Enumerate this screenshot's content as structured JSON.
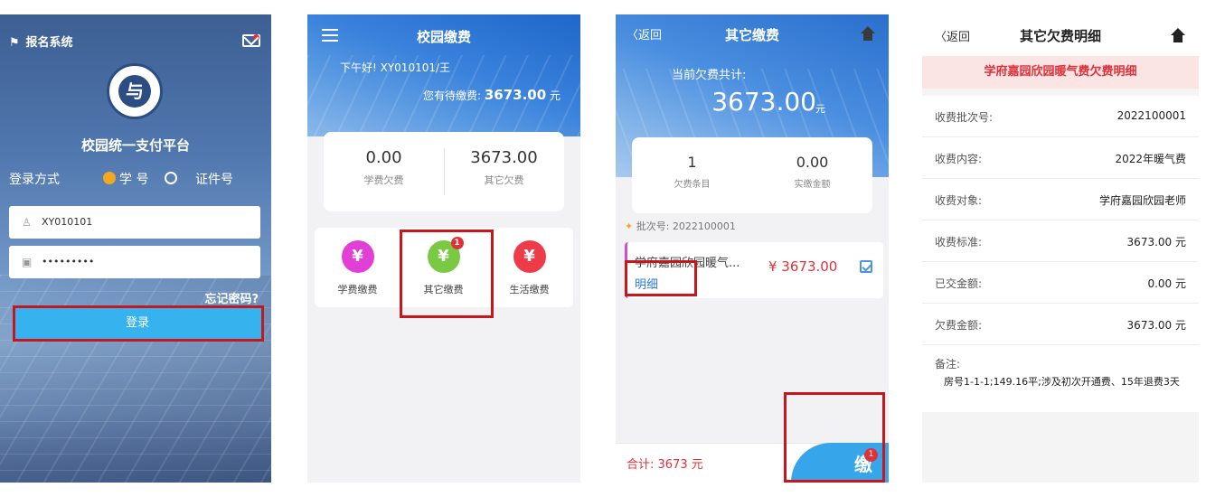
{
  "screen1": {
    "app_name": "报名系统",
    "platform_name": "校园统一支付平台",
    "login_method_label": "登录方式",
    "option_student_id": "学 号",
    "option_id_card": "证件号",
    "username_value": "XY010101",
    "password_value": "•••••••••",
    "forgot_password": "忘记密码?",
    "login_button": "登录"
  },
  "screen2": {
    "title": "校园缴费",
    "greeting": "下午好! XY010101/王",
    "pending_label": "您有待缴费:",
    "pending_amount": "3673.00",
    "pending_unit": "元",
    "stats": [
      {
        "value": "0.00",
        "label": "学费欠费"
      },
      {
        "value": "3673.00",
        "label": "其它欠费"
      }
    ],
    "tiles": [
      {
        "label": "学费缴费",
        "glyph": "¥",
        "color": "#e23fd6"
      },
      {
        "label": "其它缴费",
        "glyph": "¥",
        "color": "#7ac943",
        "badge": "1"
      },
      {
        "label": "生活缴费",
        "glyph": "¥",
        "color": "#ee3b4a"
      }
    ]
  },
  "screen3": {
    "back_label": "返回",
    "title": "其它缴费",
    "arrears_label": "当前欠费共计:",
    "arrears_amount": "3673.00",
    "arrears_unit": "元",
    "stats": [
      {
        "value": "1",
        "label": "欠费条目"
      },
      {
        "value": "0.00",
        "label": "实缴金额"
      }
    ],
    "batch_label": "批次号: 2022100001",
    "item_name": "学府嘉园欣园暖气...",
    "item_detail": "明细",
    "item_price": "¥ 3673.00",
    "total_label": "合计: 3673 元",
    "pay_button": "缴",
    "pay_badge": "1"
  },
  "screen4": {
    "back_label": "返回",
    "title": "其它欠费明细",
    "banner": "学府嘉园欣园暖气费欠费明细",
    "rows": [
      {
        "key": "收费批次号:",
        "value": "2022100001"
      },
      {
        "key": "收费内容:",
        "value": "2022年暖气费"
      },
      {
        "key": "收费对象:",
        "value": "学府嘉园欣园老师"
      },
      {
        "key": "收费标准:",
        "value": "3673.00 元"
      },
      {
        "key": "已交金额:",
        "value": "0.00 元"
      },
      {
        "key": "欠费金额:",
        "value": "3673.00 元"
      }
    ],
    "remark_label": "备注:",
    "remark_value": "房号1-1-1;149.16平;涉及初次开通费、15年退费3天"
  },
  "colors": {
    "accent_blue": "#36b2ef",
    "alert_red": "#e0313a",
    "highlight_box": "#c8161d"
  }
}
